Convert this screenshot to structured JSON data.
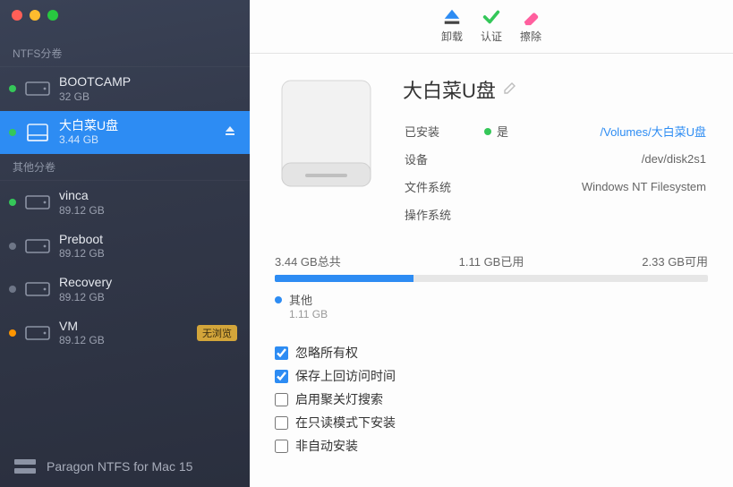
{
  "sidebar": {
    "section_ntfs": "NTFS分卷",
    "section_other": "其他分卷",
    "ntfs_items": [
      {
        "name": "BOOTCAMP",
        "size": "32 GB",
        "status": "green"
      },
      {
        "name": "大白菜U盘",
        "size": "3.44 GB",
        "status": "green",
        "selected": true,
        "ejectable": true
      }
    ],
    "other_items": [
      {
        "name": "vinca",
        "size": "89.12 GB",
        "status": "green"
      },
      {
        "name": "Preboot",
        "size": "89.12 GB",
        "status": "grey"
      },
      {
        "name": "Recovery",
        "size": "89.12 GB",
        "status": "grey"
      },
      {
        "name": "VM",
        "size": "89.12 GB",
        "status": "orange",
        "badge": "无浏览"
      }
    ],
    "footer": "Paragon NTFS for Mac 15"
  },
  "toolbar": {
    "unmount": "卸载",
    "verify": "认证",
    "erase": "擦除"
  },
  "volume": {
    "title": "大白菜U盘",
    "rows": {
      "mounted_k": "已安装",
      "mounted_v": "是",
      "mounted_path": "/Volumes/大白菜U盘",
      "device_k": "设备",
      "device_v": "/dev/disk2s1",
      "fs_k": "文件系统",
      "fs_v": "Windows NT Filesystem",
      "os_k": "操作系统",
      "os_v": ""
    }
  },
  "usage": {
    "total": "3.44 GB总共",
    "used": "1.11 GB已用",
    "free": "2.33 GB可用",
    "legend_label": "其他",
    "legend_value": "1.11 GB",
    "fill_pct": 32
  },
  "options": {
    "ignore_owner": "忽略所有权",
    "save_atime": "保存上回访问时间",
    "spotlight": "启用聚关灯搜索",
    "readonly": "在只读模式下安装",
    "noauto": "非自动安装"
  }
}
